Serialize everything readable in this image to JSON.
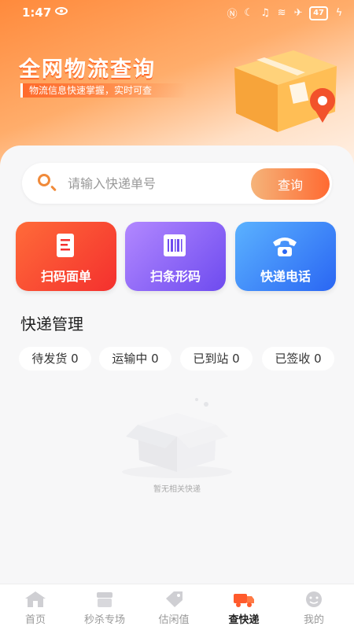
{
  "status_bar": {
    "time": "1:47",
    "battery": "47"
  },
  "hero": {
    "title": "全网物流查询",
    "subtitle": "物流信息快速掌握，实时可查"
  },
  "search": {
    "placeholder": "请输入快递单号",
    "button_label": "查询"
  },
  "quick_actions": [
    {
      "label": "扫码面单",
      "icon": "receipt-icon"
    },
    {
      "label": "扫条形码",
      "icon": "barcode-icon"
    },
    {
      "label": "快递电话",
      "icon": "phone-icon"
    }
  ],
  "section": {
    "title": "快递管理"
  },
  "status_tabs": [
    {
      "label": "待发货 0"
    },
    {
      "label": "运输中 0"
    },
    {
      "label": "已到站 0"
    },
    {
      "label": "已签收 0"
    }
  ],
  "empty_state": {
    "text": "暂无相关快递"
  },
  "bottom_nav": [
    {
      "label": "首页",
      "icon": "home-icon",
      "active": false
    },
    {
      "label": "秒杀专场",
      "icon": "shop-icon",
      "active": false
    },
    {
      "label": "估闲值",
      "icon": "tag-icon",
      "active": false
    },
    {
      "label": "查快递",
      "icon": "truck-icon",
      "active": true
    },
    {
      "label": "我的",
      "icon": "face-icon",
      "active": false
    }
  ],
  "colors": {
    "accent": "#ff6a32",
    "hero_start": "#ff8a3c",
    "scan_card": "#f4302e",
    "barcode_card": "#6e4bef",
    "phone_card": "#2a66f3"
  }
}
